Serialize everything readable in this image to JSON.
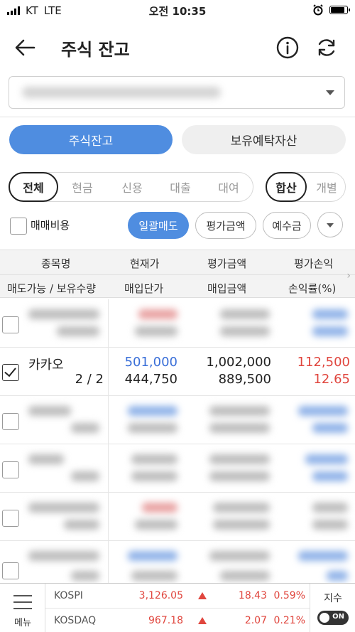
{
  "status_bar": {
    "carrier": "KT",
    "network": "LTE",
    "time": "오전 10:35"
  },
  "header": {
    "title": "주식 잔고"
  },
  "tabs": [
    {
      "label": "주식잔고",
      "active": true
    },
    {
      "label": "보유예탁자산",
      "active": false
    }
  ],
  "filters": {
    "types": [
      "전체",
      "현금",
      "신용",
      "대출",
      "대여"
    ],
    "selected_type": "전체",
    "view_modes": [
      "합산",
      "개별"
    ],
    "selected_view": "합산"
  },
  "options": {
    "fee_label": "매매비용",
    "bulk_sell": "일괄매도",
    "eval_amount": "평가금액",
    "deposit": "예수금"
  },
  "table": {
    "header_row1": [
      "종목명",
      "현재가",
      "평가금액",
      "평가손익"
    ],
    "header_row2": [
      "매도가능 / 보유수량",
      "매입단가",
      "매입금액",
      "손익률(%)"
    ],
    "visible_row": {
      "name": "카카오",
      "quantity": "2 / 2",
      "current_price": "501,000",
      "avg_price": "444,750",
      "eval_amount": "1,002,000",
      "purchase_amount": "889,500",
      "profit": "112,500",
      "profit_rate": "12.65",
      "checked": true
    }
  },
  "bottom_bar": {
    "menu_label": "메뉴",
    "indices": [
      {
        "name": "KOSPI",
        "value": "3,126.05",
        "change": "18.43",
        "rate": "0.59%",
        "direction": "up"
      },
      {
        "name": "KOSDAQ",
        "value": "967.18",
        "change": "2.07",
        "rate": "0.21%",
        "direction": "up"
      }
    ],
    "index_label": "지수",
    "toggle_label": "ON"
  },
  "colors": {
    "accent": "#4f8de0",
    "up": "#e0463e",
    "down": "#3a6fd8"
  }
}
